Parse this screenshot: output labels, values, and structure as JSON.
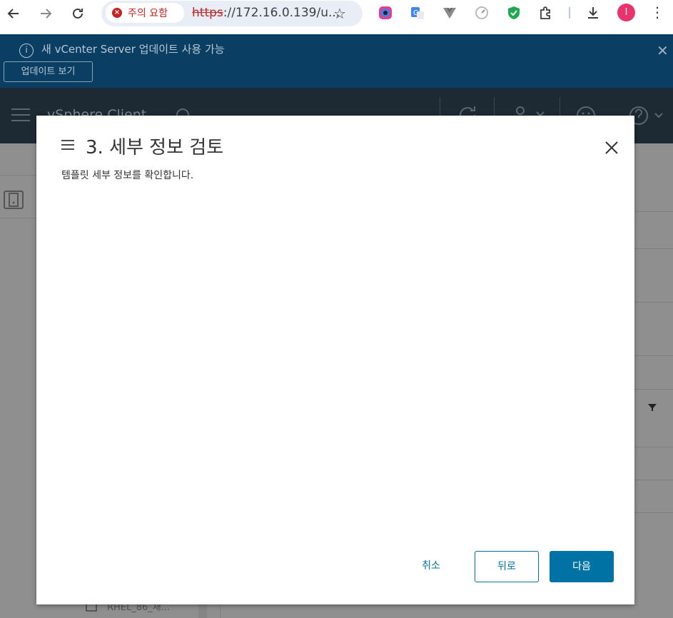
{
  "browser": {
    "security_label": "주의 요함",
    "url_scheme": "https",
    "url_rest": "://172.16.0.139/u...",
    "avatar_letter": "I"
  },
  "banner": {
    "message": "새 vCenter Server 업데이트 사용 가능",
    "view_updates_label": "업데이트 보기"
  },
  "header": {
    "title": "vSphere Client"
  },
  "modal": {
    "title": "3. 세부 정보 검토",
    "subtitle": "템플릿 세부 정보를 확인합니다.",
    "cancel_label": "취소",
    "back_label": "뒤로",
    "next_label": "다음"
  },
  "background": {
    "peek_item": "RHEL_86_새..."
  },
  "colors": {
    "primary": "#0072a3",
    "banner_bg": "#0a3f63",
    "header_bg": "#1d2a33"
  }
}
